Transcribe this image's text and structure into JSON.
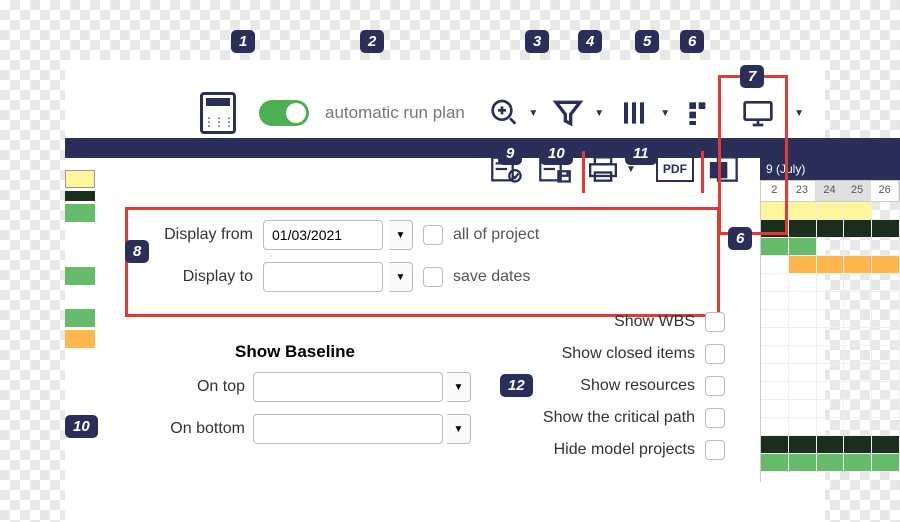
{
  "toolbar": {
    "auto_run_label": "automatic run plan"
  },
  "timeline": {
    "month_label": "9 (July)",
    "days": [
      "2",
      "23",
      "24",
      "25",
      "26"
    ]
  },
  "panel": {
    "display_from_label": "Display from",
    "display_to_label": "Display to",
    "date_from": "01/03/2021",
    "date_to": "",
    "all_project_label": "all of project",
    "save_dates_label": "save dates",
    "baseline_title": "Show Baseline",
    "on_top_label": "On top",
    "on_bottom_label": "On bottom"
  },
  "options": {
    "show_wbs": "Show WBS",
    "show_closed": "Show closed items",
    "show_resources": "Show resources",
    "show_critical": "Show the critical path",
    "hide_model": "Hide model projects"
  },
  "badges": {
    "b1": "1",
    "b2": "2",
    "b3": "3",
    "b4": "4",
    "b5": "5",
    "b6": "6",
    "b7": "7",
    "b8": "8",
    "b9": "9",
    "b10": "10",
    "b11": "11",
    "b12": "12"
  }
}
